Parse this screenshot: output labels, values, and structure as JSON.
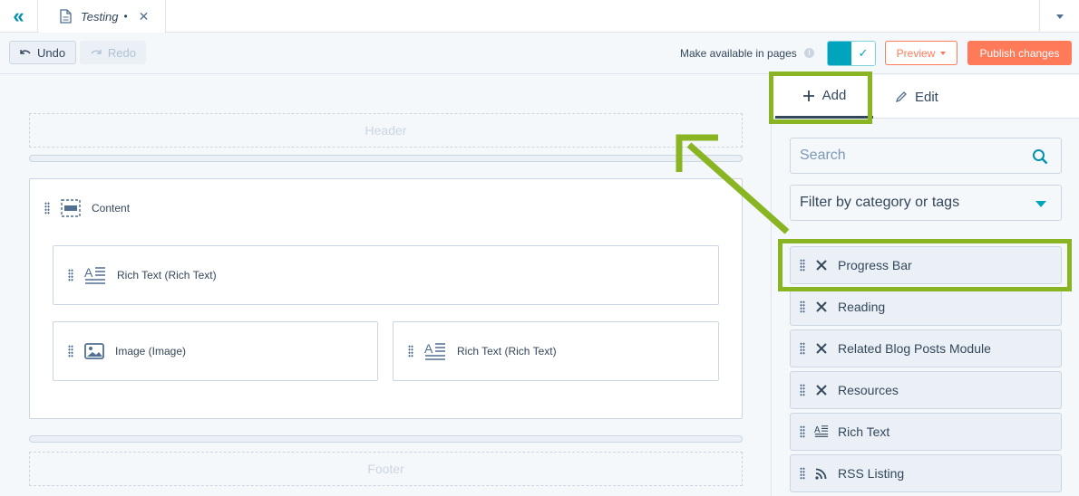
{
  "tabbar": {
    "tab_label": "Testing",
    "tab_dot": "•",
    "tab_close": "✕",
    "collapse_glyph": "«"
  },
  "toolbar": {
    "undo_label": "Undo",
    "redo_label": "Redo",
    "availability_label": "Make available in pages",
    "toggle_state": "on",
    "preview_label": "Preview",
    "publish_label": "Publish changes",
    "accent_color": "#ff7a59",
    "toggle_color": "#00a4bd"
  },
  "canvas": {
    "header_label": "Header",
    "footer_label": "Footer",
    "content_label": "Content",
    "modules": [
      {
        "label": "Rich Text (Rich Text)",
        "icon": "rich-text-icon"
      },
      {
        "label": "Image (Image)",
        "icon": "image-icon"
      },
      {
        "label": "Rich Text (Rich Text)",
        "icon": "rich-text-icon"
      }
    ]
  },
  "panel": {
    "tabs": [
      {
        "label": "Add",
        "icon": "plus-icon",
        "active": true
      },
      {
        "label": "Edit",
        "icon": "pencil-icon",
        "active": false
      }
    ],
    "search_placeholder": "Search",
    "filter_label": "Filter by category or tags",
    "items": [
      {
        "label": "Progress Bar",
        "icon": "x-icon"
      },
      {
        "label": "Reading",
        "icon": "x-icon"
      },
      {
        "label": "Related Blog Posts Module",
        "icon": "x-icon"
      },
      {
        "label": "Resources",
        "icon": "x-icon"
      },
      {
        "label": "Rich Text",
        "icon": "rich-text-icon"
      },
      {
        "label": "RSS Listing",
        "icon": "rss-icon"
      }
    ]
  },
  "annotation": {
    "highlight_color": "#8ab522"
  }
}
